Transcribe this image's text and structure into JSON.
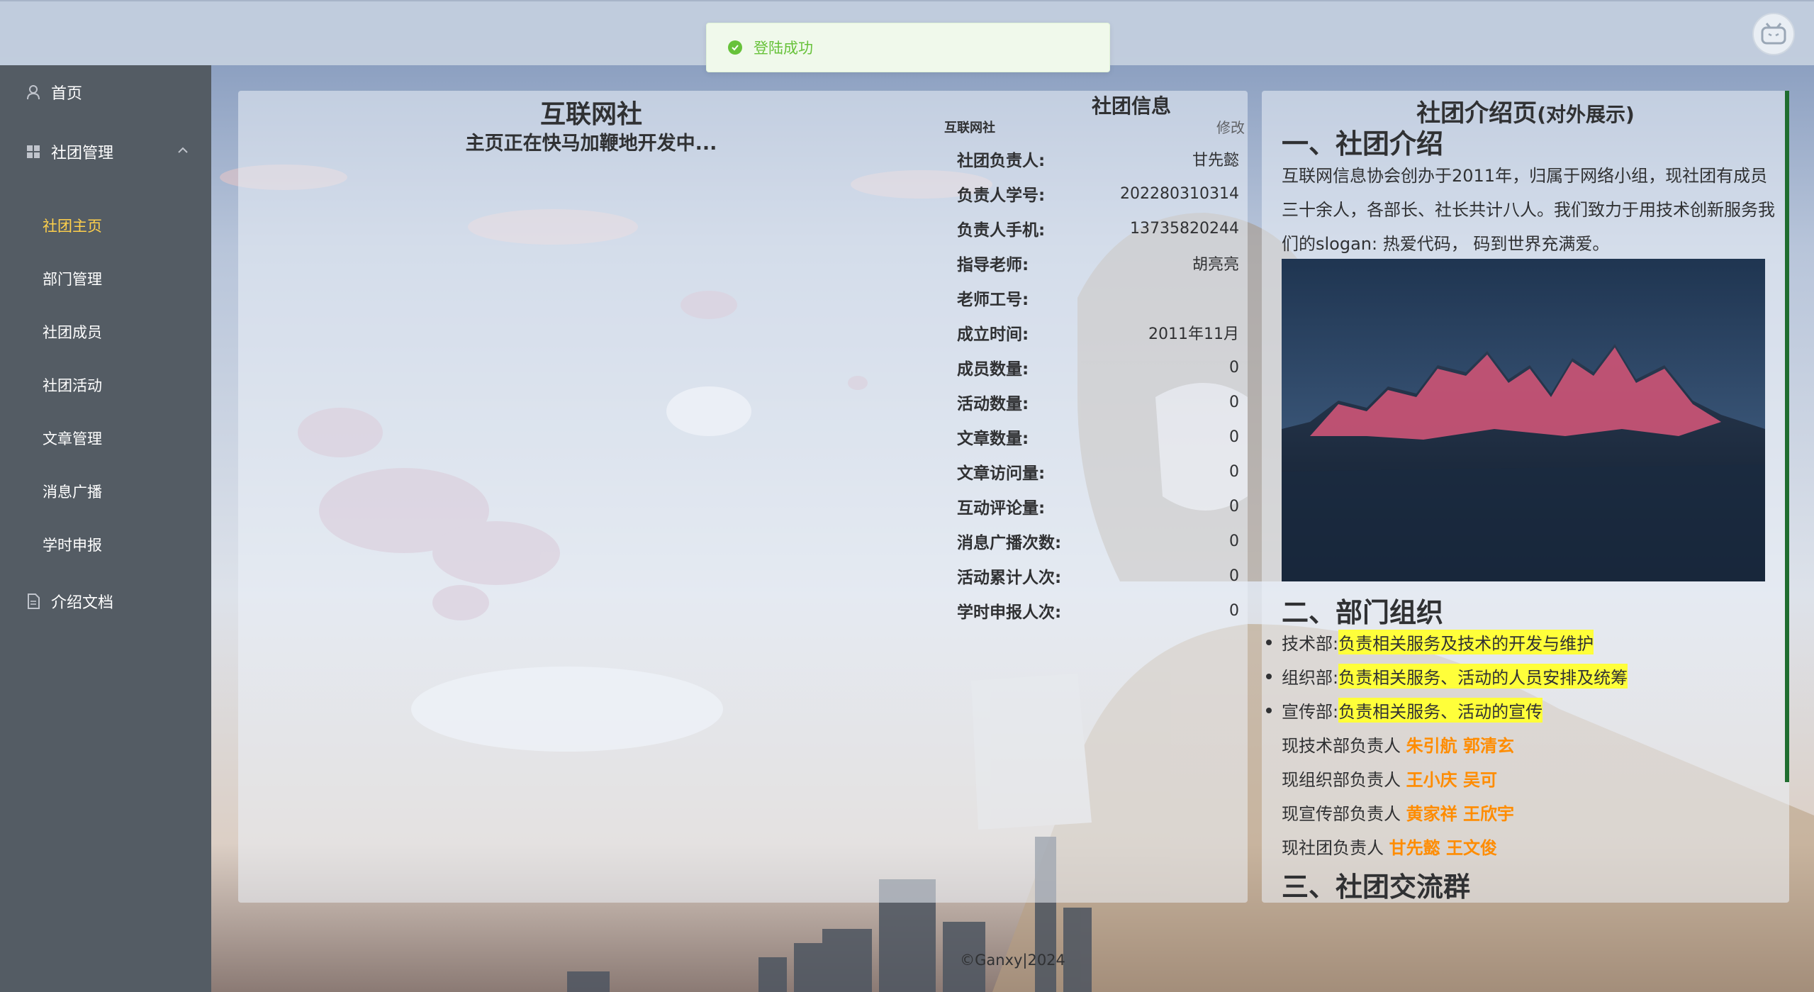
{
  "toast": {
    "message": "登陆成功"
  },
  "sidebar": {
    "home": "首页",
    "club_manage": "社团管理",
    "sub_items": [
      "社团主页",
      "部门管理",
      "社团成员",
      "社团活动",
      "文章管理",
      "消息广播",
      "学时申报"
    ],
    "docs": "介绍文档"
  },
  "main": {
    "club_name": "互联网社",
    "dev_note": "主页正在快马加鞭地开发中...",
    "info": {
      "title": "社团信息",
      "sub_name": "互联网社",
      "edit": "修改",
      "rows": [
        {
          "k": "社团负责人:",
          "v": "甘先懿"
        },
        {
          "k": "负责人学号:",
          "v": "202280310314"
        },
        {
          "k": "负责人手机:",
          "v": "13735820244"
        },
        {
          "k": "指导老师:",
          "v": "胡亮亮"
        },
        {
          "k": "老师工号:",
          "v": ""
        },
        {
          "k": "成立时间:",
          "v": "2011年11月"
        },
        {
          "k": "成员数量:",
          "v": "0"
        },
        {
          "k": "活动数量:",
          "v": "0"
        },
        {
          "k": "文章数量:",
          "v": "0"
        },
        {
          "k": "文章访问量:",
          "v": "0"
        },
        {
          "k": "互动评论量:",
          "v": "0"
        },
        {
          "k": "消息广播次数:",
          "v": "0"
        },
        {
          "k": "活动累计人次:",
          "v": "0"
        },
        {
          "k": "学时申报人次:",
          "v": "0"
        }
      ]
    }
  },
  "intro": {
    "title": "社团介绍页",
    "title_suffix": "(对外展示)",
    "h_intro": "一、社团介绍",
    "intro_text": "互联网信息协会创办于2011年，归属于网络小组，现社团有成员三十余人，各部长、社长共计八人。我们致力于用技术创新服务我们的slogan: 热爱代码， 码到世界充满爱。",
    "h_dept": "二、部门组织",
    "depts": [
      {
        "name": "技术部:",
        "desc": "负责相关服务及技术的开发与维护"
      },
      {
        "name": "组织部:",
        "desc": "负责相关服务、活动的人员安排及统筹"
      },
      {
        "name": "宣传部:",
        "desc": "负责相关服务、活动的宣传"
      }
    ],
    "leads": [
      {
        "label": "现技术部负责人",
        "names": "朱引航 郭清玄"
      },
      {
        "label": "现组织部负责人",
        "names": "王小庆 吴可"
      },
      {
        "label": "现宣传部负责人",
        "names": "黄家祥 王欣宇"
      },
      {
        "label": "现社团负责人",
        "names": "甘先懿 王文俊"
      }
    ],
    "h_group": "三、社团交流群"
  },
  "footer": {
    "copyright": "©Ganxy|2024"
  },
  "colors": {
    "sidebar_bg": "#545c64",
    "active": "#ffd04b",
    "success": "#67c23a",
    "highlight": "#ffff3a",
    "lead_names": "#ff8c00"
  }
}
